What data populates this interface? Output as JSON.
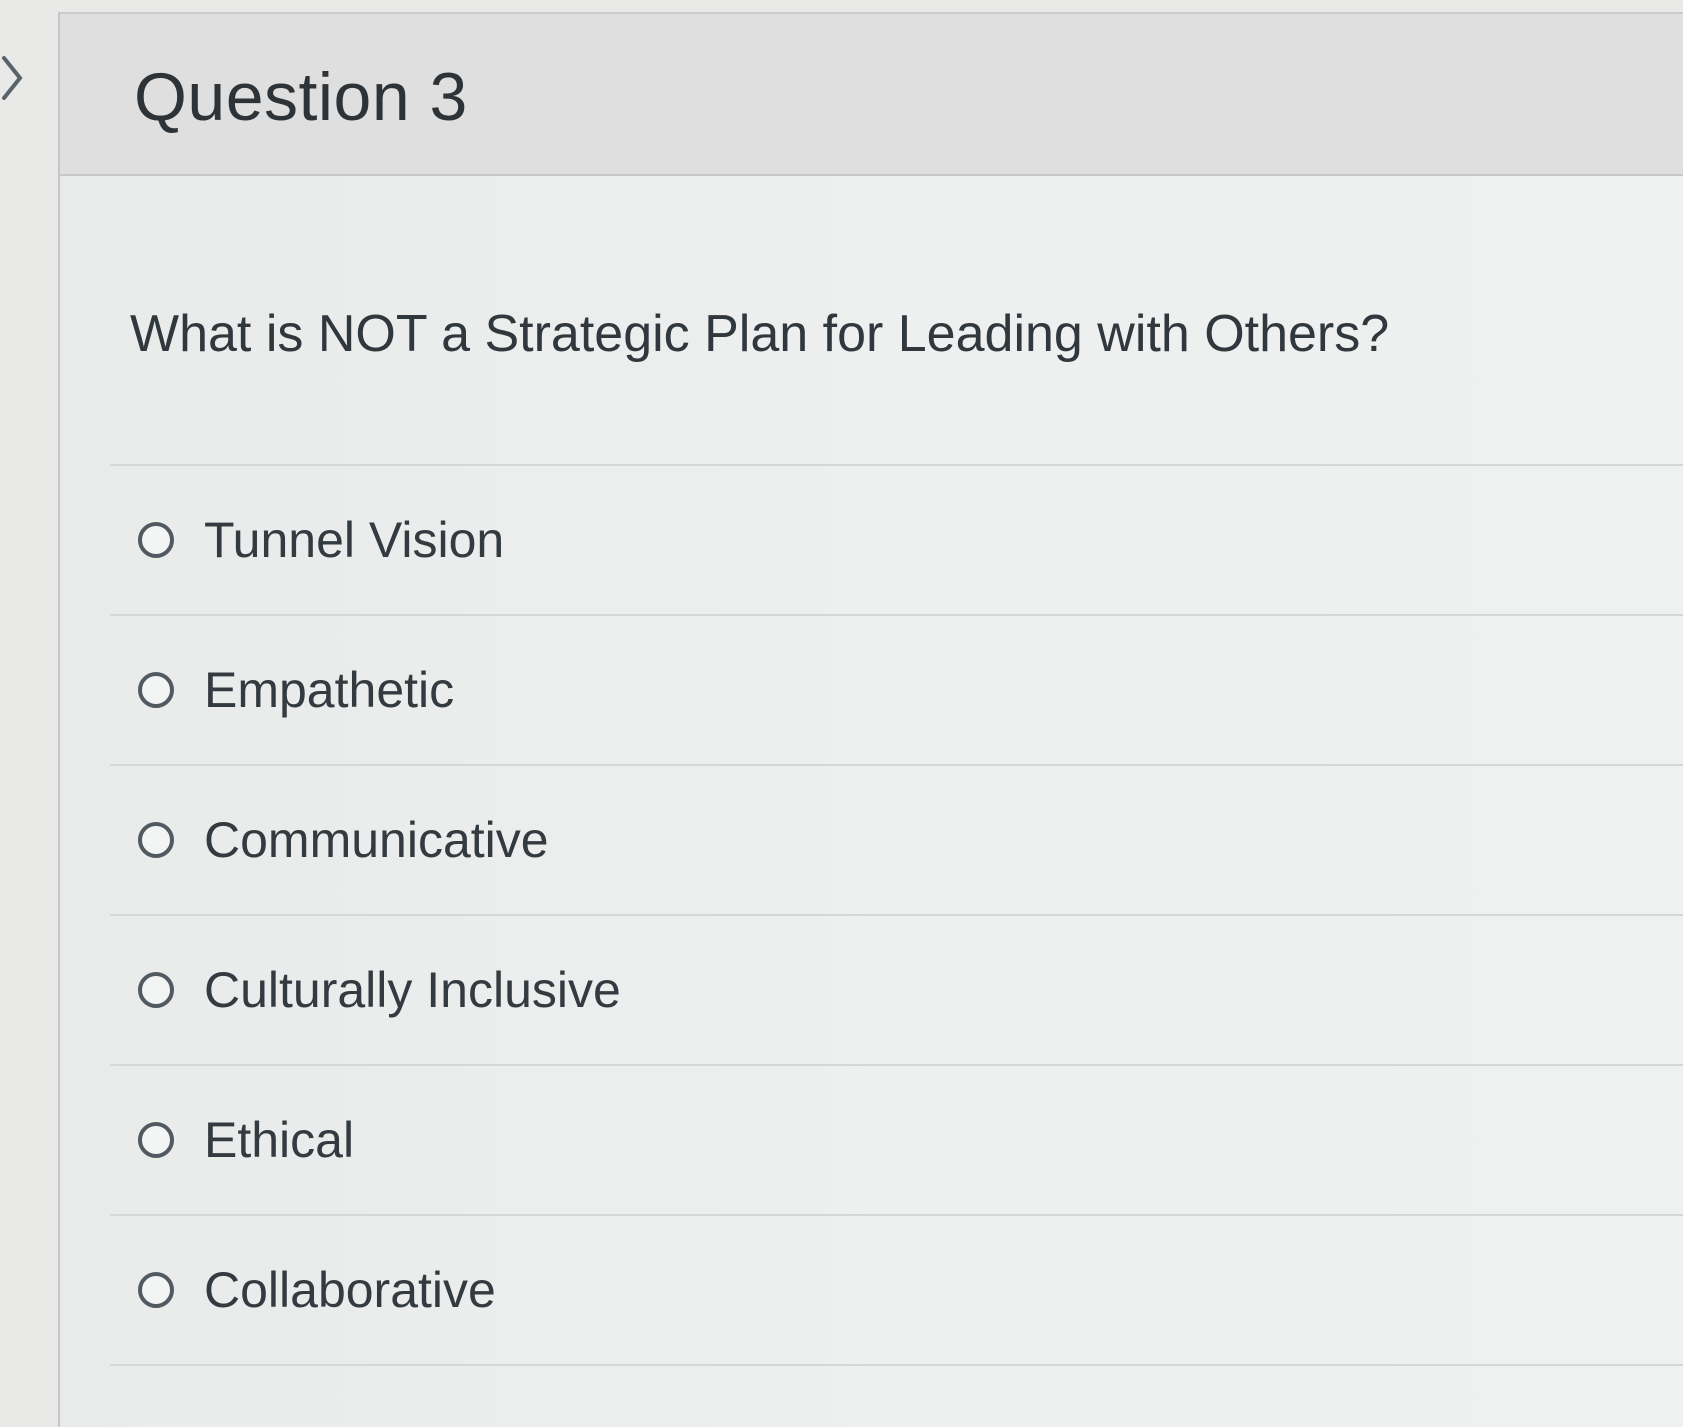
{
  "question": {
    "title": "Question 3",
    "prompt": "What is NOT a Strategic Plan for Leading with Others?",
    "options": [
      {
        "label": "Tunnel Vision",
        "selected": false
      },
      {
        "label": "Empathetic",
        "selected": false
      },
      {
        "label": "Communicative",
        "selected": false
      },
      {
        "label": "Culturally Inclusive",
        "selected": false
      },
      {
        "label": "Ethical",
        "selected": false
      },
      {
        "label": "Collaborative",
        "selected": false
      }
    ]
  },
  "icons": {
    "sidebar_toggle": "chevron-right-icon",
    "option_control": "radio-circle-icon"
  }
}
